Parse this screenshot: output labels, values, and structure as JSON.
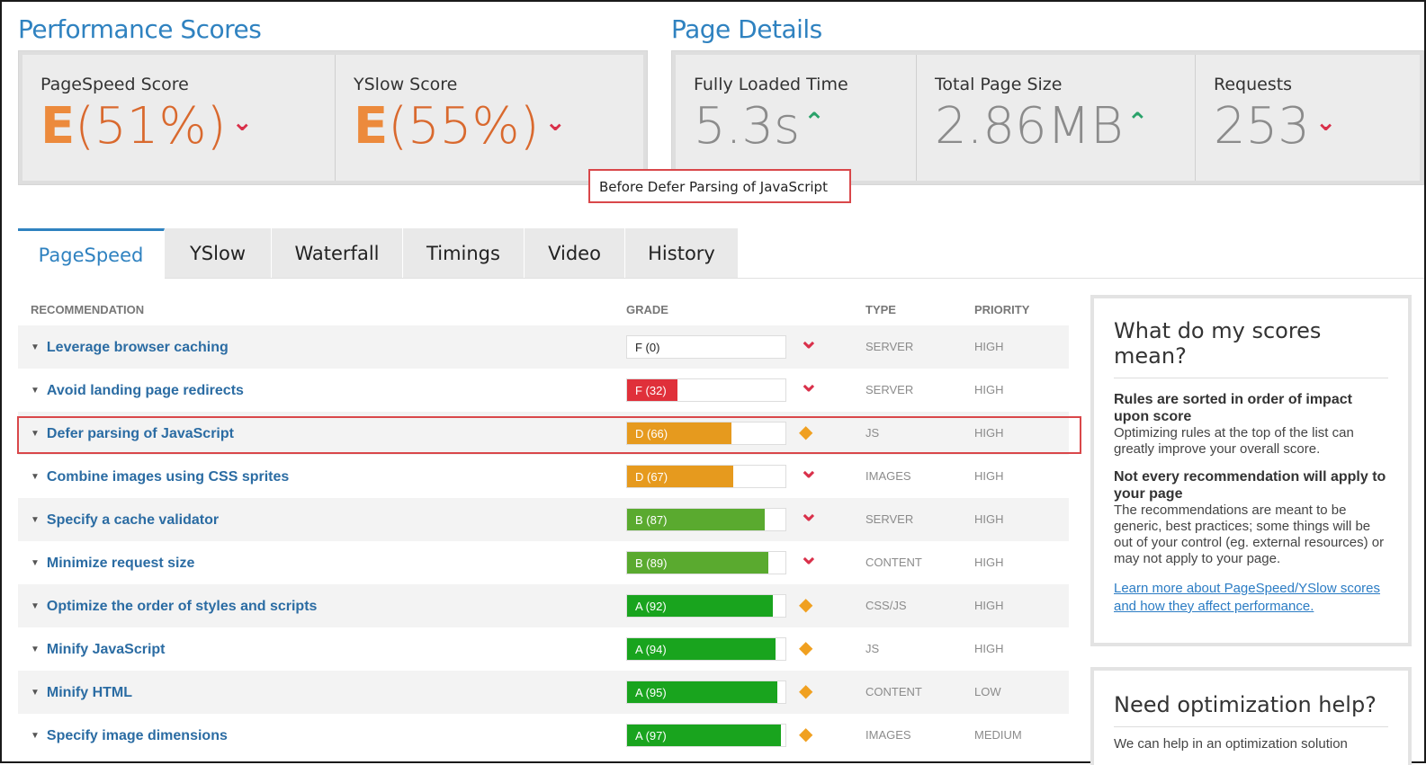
{
  "performance": {
    "title": "Performance Scores",
    "pagespeed": {
      "label": "PageSpeed Score",
      "grade": "E",
      "pct": "(51%)"
    },
    "yslow": {
      "label": "YSlow Score",
      "grade": "E",
      "pct": "(55%)"
    }
  },
  "details": {
    "title": "Page Details",
    "load_time": {
      "label": "Fully Loaded Time",
      "value": "5.3s"
    },
    "page_size": {
      "label": "Total Page Size",
      "value": "2.86MB"
    },
    "requests": {
      "label": "Requests",
      "value": "253"
    }
  },
  "tooltip": "Before Defer Parsing of JavaScript",
  "tabs": [
    "PageSpeed",
    "YSlow",
    "Waterfall",
    "Timings",
    "Video",
    "History"
  ],
  "table": {
    "headers": {
      "recommendation": "RECOMMENDATION",
      "grade": "GRADE",
      "type": "TYPE",
      "priority": "PRIORITY"
    },
    "rows": [
      {
        "name": "Leverage browser caching",
        "grade": "F (0)",
        "score": 0,
        "color": "#d9304a",
        "trend": "down",
        "type": "SERVER",
        "priority": "HIGH"
      },
      {
        "name": "Avoid landing page redirects",
        "grade": "F (32)",
        "score": 32,
        "color": "#e0303a",
        "trend": "down",
        "type": "SERVER",
        "priority": "HIGH"
      },
      {
        "name": "Defer parsing of JavaScript",
        "grade": "D (66)",
        "score": 66,
        "color": "#e69a1e",
        "trend": "neutral",
        "type": "JS",
        "priority": "HIGH"
      },
      {
        "name": "Combine images using CSS sprites",
        "grade": "D (67)",
        "score": 67,
        "color": "#e69a1e",
        "trend": "down",
        "type": "IMAGES",
        "priority": "HIGH"
      },
      {
        "name": "Specify a cache validator",
        "grade": "B (87)",
        "score": 87,
        "color": "#5aaa2f",
        "trend": "down",
        "type": "SERVER",
        "priority": "HIGH"
      },
      {
        "name": "Minimize request size",
        "grade": "B (89)",
        "score": 89,
        "color": "#5aaa2f",
        "trend": "down",
        "type": "CONTENT",
        "priority": "HIGH"
      },
      {
        "name": "Optimize the order of styles and scripts",
        "grade": "A (92)",
        "score": 92,
        "color": "#19a41e",
        "trend": "neutral",
        "type": "CSS/JS",
        "priority": "HIGH"
      },
      {
        "name": "Minify JavaScript",
        "grade": "A (94)",
        "score": 94,
        "color": "#19a41e",
        "trend": "neutral",
        "type": "JS",
        "priority": "HIGH"
      },
      {
        "name": "Minify HTML",
        "grade": "A (95)",
        "score": 95,
        "color": "#19a41e",
        "trend": "neutral",
        "type": "CONTENT",
        "priority": "LOW"
      },
      {
        "name": "Specify image dimensions",
        "grade": "A (97)",
        "score": 97,
        "color": "#19a41e",
        "trend": "neutral",
        "type": "IMAGES",
        "priority": "MEDIUM"
      }
    ]
  },
  "sidebar": {
    "scores_title": "What do my scores mean?",
    "rule1_bold": "Rules are sorted in order of impact upon score",
    "rule1_text": "Optimizing rules at the top of the list can greatly improve your overall score.",
    "rule2_bold": "Not every recommendation will apply to your page",
    "rule2_text": "The recommendations are meant to be generic, best practices; some things will be out of your control (eg. external resources) or may not apply to your page.",
    "learn_link": "Learn more about PageSpeed/YSlow scores and how they affect performance.",
    "help_title": "Need optimization help?",
    "help_text": "We can help in an optimization solution"
  },
  "colors": {
    "accent": "#2f82c0",
    "grade_orange": "#ec8a3c",
    "down_arrow": "#d9304a",
    "up_arrow": "#2aa26a",
    "neutral_diamond": "#f0a020"
  },
  "icons": {
    "trend_down": "chevron-down-icon",
    "trend_up": "chevron-up-icon",
    "trend_neutral": "diamond-icon",
    "expand": "triangle-down-icon"
  }
}
